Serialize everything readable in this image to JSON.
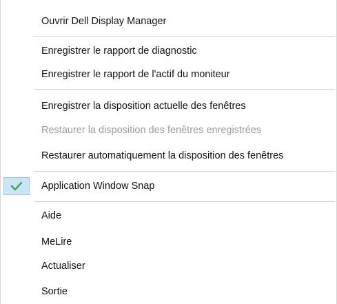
{
  "menu": {
    "items": [
      {
        "label": "Ouvrir Dell Display Manager",
        "enabled": true,
        "checked": false
      },
      {
        "label": "Enregistrer le rapport de diagnostic",
        "enabled": true,
        "checked": false
      },
      {
        "label": "Enregistrer le rapport de l'actif du moniteur",
        "enabled": true,
        "checked": false
      },
      {
        "label": "Enregistrer la disposition actuelle des fenêtres",
        "enabled": true,
        "checked": false
      },
      {
        "label": "Restaurer la disposition des fenêtres enregistrées",
        "enabled": false,
        "checked": false
      },
      {
        "label": "Restaurer automatiquement la disposition des fenêtres",
        "enabled": true,
        "checked": false
      },
      {
        "label": "Application Window Snap",
        "enabled": true,
        "checked": true
      },
      {
        "label": "Aide",
        "enabled": true,
        "checked": false
      },
      {
        "label": "MeLire",
        "enabled": true,
        "checked": false
      },
      {
        "label": "Actualiser",
        "enabled": true,
        "checked": false
      },
      {
        "label": "Sortie",
        "enabled": true,
        "checked": false
      }
    ],
    "check_icon": "checkmark-icon",
    "colors": {
      "text": "#111111",
      "disabled_text": "#9a9a9a",
      "check_green": "#2fa84f",
      "check_highlight": "#cce4f7",
      "separator": "#d0d0d0"
    }
  }
}
